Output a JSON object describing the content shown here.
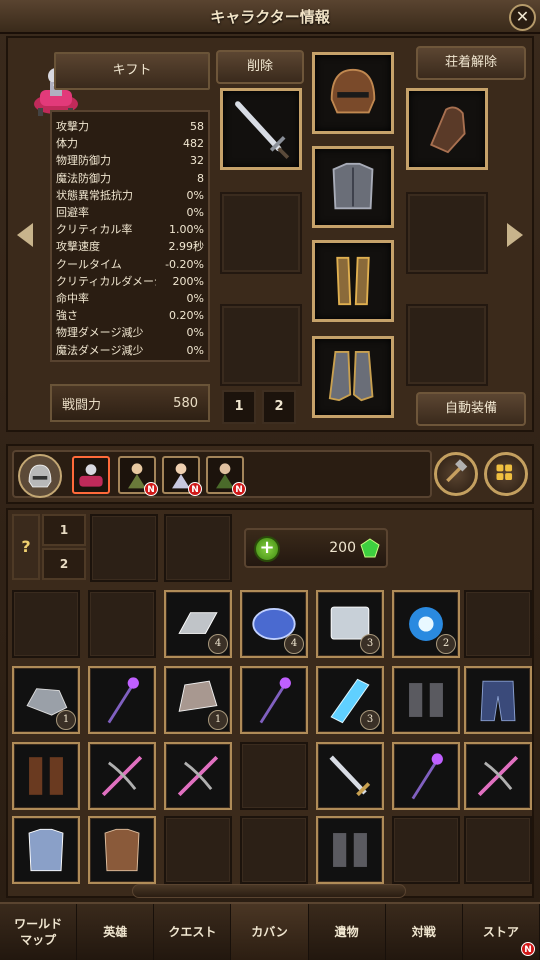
{
  "header": {
    "title": "キャラクター情報",
    "close_icon": "close-icon"
  },
  "character": {
    "gift_label": "キフト",
    "delete_label": "削除",
    "unequip_label": "荘着解除",
    "auto_equip_label": "自動装備",
    "power_label": "戦闘力",
    "power_value": "580",
    "pages": [
      "1",
      "2"
    ],
    "stats": [
      {
        "label": "攻撃力",
        "value": "58"
      },
      {
        "label": "体力",
        "value": "482"
      },
      {
        "label": "物理防御力",
        "value": "32"
      },
      {
        "label": "魔法防御力",
        "value": "8"
      },
      {
        "label": "状態異常抵抗力",
        "value": "0%"
      },
      {
        "label": "回避率",
        "value": "0%"
      },
      {
        "label": "クリティカル率",
        "value": "1.00%"
      },
      {
        "label": "攻撃速度",
        "value": "2.99秒"
      },
      {
        "label": "クールタイム",
        "value": "-0.20%"
      },
      {
        "label": "クリティカルダメージ",
        "value": "200%"
      },
      {
        "label": "命中率",
        "value": "0%"
      },
      {
        "label": "強さ",
        "value": "0.20%"
      },
      {
        "label": "物理ダメージ減少",
        "value": "0%"
      },
      {
        "label": "魔法ダメージ減少",
        "value": "0%"
      }
    ],
    "equipment": [
      "sword-icon",
      "helmet-icon",
      "glove-icon",
      "armor-icon",
      "greaves-icon",
      "boots-icon"
    ]
  },
  "heroes": {
    "new_badge": "N",
    "list": [
      "knight-hero",
      "mage-hero",
      "healer-hero",
      "archer-hero"
    ]
  },
  "inventory": {
    "question": "?",
    "pages": [
      "1",
      "2"
    ],
    "gems": "200",
    "quantities": {
      "q1": "4",
      "q2": "4",
      "q3": "3",
      "q4": "2",
      "q5": "1",
      "q6": "1",
      "q7": "3"
    }
  },
  "nav": {
    "items": [
      "ワールド\nマップ",
      "英雄",
      "クエスト",
      "カバン",
      "遺物",
      "対戦",
      "ストア"
    ],
    "store_badge": "N"
  },
  "colors": {
    "gold_border": "#c6a26a",
    "panel": "#3b2a1b",
    "badge_red": "#d01818"
  }
}
